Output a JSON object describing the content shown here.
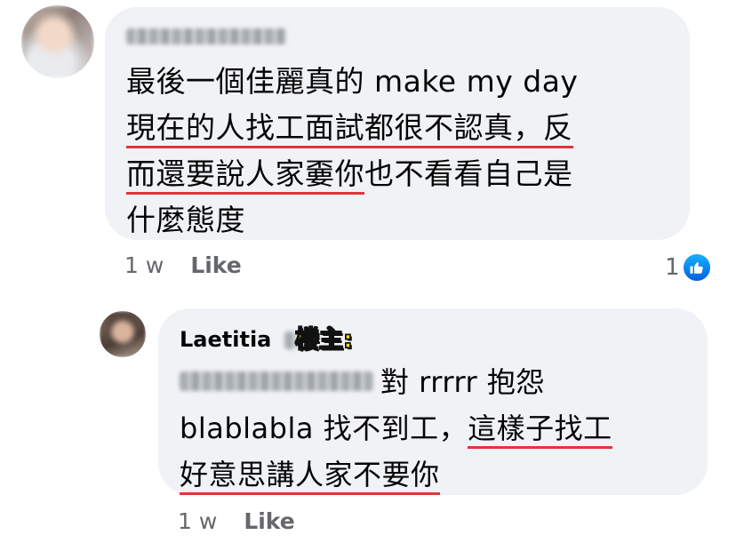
{
  "comment1": {
    "lines": [
      "最後一個佳麗真的 make my day",
      "現在的人找工面試都很不認真，反",
      "而還要說人家嫑你也不看看自己是",
      "什麼態度"
    ],
    "line3_underlined": "而還要說人家嫑你",
    "line3_rest": "也不看看自己是",
    "time": "1 w",
    "like_label": "Like",
    "reaction_count": "1",
    "reaction_icon": "thumbs-up-icon",
    "reaction_color": "#1877f2"
  },
  "reply1": {
    "author": "Laetitia",
    "op_tag": "楼主:",
    "line1_rest": "對 rrrrr 抱怨",
    "line2_plain": "blablabla 找不到工，",
    "line2_underlined": "這樣子找工",
    "line3": "好意思講人家不要你",
    "time": "1 w",
    "like_label": "Like"
  },
  "colors": {
    "bubble": "#f0f2f5",
    "underline": "#e4333a",
    "meta_text": "#65676b",
    "op_tag": "#ffe000"
  }
}
